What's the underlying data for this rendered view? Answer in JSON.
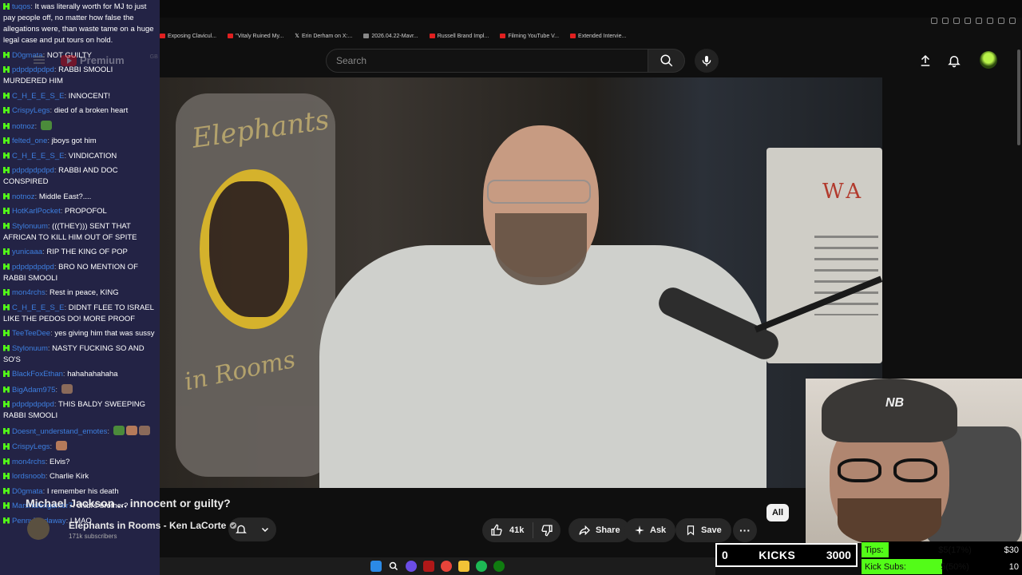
{
  "bookmarks": [
    "Exposing Clavicul...",
    "\"Vitaly Ruined My...",
    "Erin Derham on X:...",
    "2026.04.22-Mavr...",
    "Russell Brand Impl...",
    "Filming YouTube V...",
    "Extended Intervie..."
  ],
  "yt": {
    "logo_text": "Premium",
    "logo_region": "GB",
    "search_placeholder": "Search"
  },
  "video": {
    "title": "Michael Jackson ... innocent or guilty?",
    "channel": "Elephants in Rooms - Ken LaCorte",
    "subscribers": "171k subscribers",
    "likes": "41k",
    "share_label": "Share",
    "ask_label": "Ask",
    "save_label": "Save",
    "chip_all": "All",
    "sign_script_top": "Elephants",
    "sign_script_bottom": "in Rooms",
    "poster_text": "WA"
  },
  "chat": [
    {
      "user": "tuqos",
      "text": "It was literally worth for MJ to just pay people off, no matter how false the allegations were, than waste tame on a huge legal case and put tours on hold."
    },
    {
      "user": "D0gmata",
      "text": "NOT GUILTY"
    },
    {
      "user": "pdpdpdpdpd",
      "text": "RABBI SMOOLI MURDERED HIM"
    },
    {
      "user": "C_H_E_E_S_E",
      "text": "INNOCENT!"
    },
    {
      "user": "CrispyLegs",
      "text": "died of a broken heart"
    },
    {
      "user": "notnoz",
      "text": ""
    },
    {
      "user": "felted_one",
      "text": "jboys got him"
    },
    {
      "user": "C_H_E_E_S_E",
      "text": "VINDICATION"
    },
    {
      "user": "pdpdpdpdpd",
      "text": "RABBI AND DOC CONSPIRED"
    },
    {
      "user": "notnoz",
      "text": "Middle East?...."
    },
    {
      "user": "HotKarlPocket",
      "text": "PROPOFOL"
    },
    {
      "user": "Stylonuum",
      "text": "(((THEY))) SENT THAT AFRICAN TO KILL HIM OUT OF SPITE"
    },
    {
      "user": "yunicaaa",
      "text": "RIP THE KING OF POP"
    },
    {
      "user": "pdpdpdpdpd",
      "text": "BRO NO MENTION OF RABBI SMOOLI"
    },
    {
      "user": "mon4rchs",
      "text": "Rest in peace, KING"
    },
    {
      "user": "C_H_E_E_S_E",
      "text": "DIDNT FLEE TO ISRAEL LIKE THE PEDOS DO! MORE PROOF"
    },
    {
      "user": "TeeTeeDee",
      "text": "yes giving him that was sussy"
    },
    {
      "user": "Stylonuum",
      "text": "NASTY FUCKING SO AND SO'S"
    },
    {
      "user": "BlackFoxEthan",
      "text": "hahahahahaha"
    },
    {
      "user": "BigAdam975",
      "text": ""
    },
    {
      "user": "pdpdpdpdpd",
      "text": "THIS BALDY SWEEPING RABBI SMOOLI"
    },
    {
      "user": "Doesnt_understand_emotes",
      "text": ""
    },
    {
      "user": "CrispyLegs",
      "text": ""
    },
    {
      "user": "mon4rchs",
      "text": "Elvis?"
    },
    {
      "user": "lordsnoob",
      "text": "Charlie Kirk"
    },
    {
      "user": "D0gmata",
      "text": "I remember his death"
    },
    {
      "user": "Marshalexgamer7",
      "text": "chibi's brother?"
    },
    {
      "user": "PennyTardaway",
      "text": "LMAO"
    }
  ],
  "overlay": {
    "kicks_count": "0",
    "kicks_label": "KICKS",
    "kicks_goal": "3000",
    "tips_label": "Tips:",
    "tips_value": "$5(17%)",
    "tips_target": "$30",
    "tips_fraction": 0.17,
    "subs_label": "Kick Subs:",
    "subs_value": "5(50%)",
    "subs_target": "10",
    "subs_fraction": 0.5,
    "cam_hat_logo": "NB"
  },
  "colors": {
    "kick_green": "#53fc18",
    "chat_bg": "#26264e",
    "username": "#3d7fe0"
  }
}
